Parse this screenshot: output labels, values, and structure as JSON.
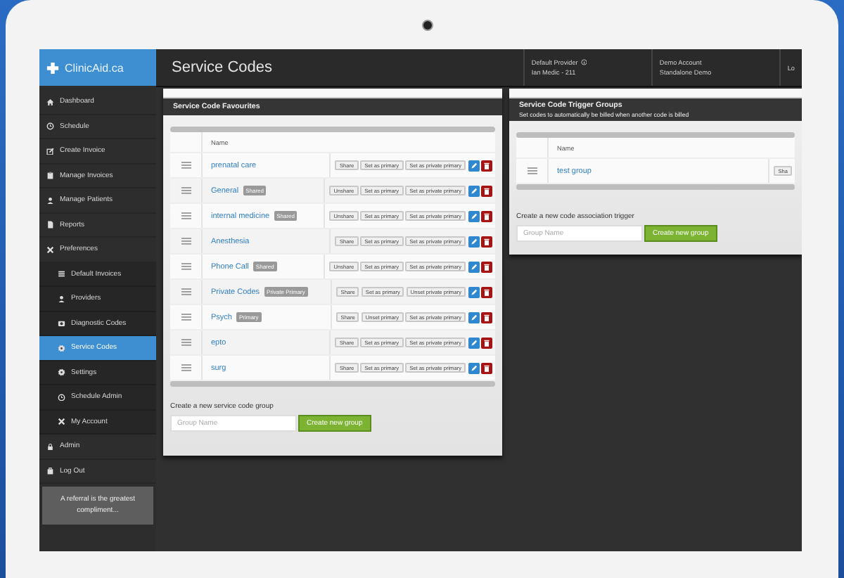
{
  "logo": "ClinicAid.ca",
  "sidebar": {
    "items": [
      {
        "label": "Dashboard",
        "selected": false
      },
      {
        "label": "Schedule",
        "selected": false
      },
      {
        "label": "Create Invoice",
        "selected": false
      },
      {
        "label": "Manage Invoices",
        "selected": false
      },
      {
        "label": "Manage Patients",
        "selected": false
      },
      {
        "label": "Reports",
        "selected": false
      },
      {
        "label": "Preferences",
        "selected": false,
        "children": [
          {
            "label": "Default Invoices",
            "selected": false
          },
          {
            "label": "Providers",
            "selected": false
          },
          {
            "label": "Diagnostic Codes",
            "selected": false
          },
          {
            "label": "Service Codes",
            "selected": true
          },
          {
            "label": "Settings",
            "selected": false
          },
          {
            "label": "Schedule Admin",
            "selected": false
          },
          {
            "label": "My Account",
            "selected": false
          }
        ]
      },
      {
        "label": "Admin",
        "selected": false
      },
      {
        "label": "Log Out",
        "selected": false
      }
    ],
    "promo": "A referral is the greatest compliment..."
  },
  "header": {
    "title": "Service Codes",
    "info": [
      {
        "label": "Default Provider",
        "info_icon": true,
        "value": "Ian Medic - 211"
      },
      {
        "label": "Demo Account",
        "value": "Standalone Demo"
      },
      {
        "label": "Lo"
      }
    ]
  },
  "favourites": {
    "title": "Service Code Favourites",
    "column": "Name",
    "rows": [
      {
        "name": "prenatal care",
        "actions": [
          "Share",
          "Set as primary",
          "Set as private primary"
        ]
      },
      {
        "name": "General",
        "badge": "Shared",
        "actions": [
          "Unshare",
          "Set as primary",
          "Set as private primary"
        ]
      },
      {
        "name": "internal medicine",
        "badge": "Shared",
        "actions": [
          "Unshare",
          "Set as primary",
          "Set as private primary"
        ]
      },
      {
        "name": "Anesthesia",
        "actions": [
          "Share",
          "Set as primary",
          "Set as private primary"
        ]
      },
      {
        "name": "Phone Call",
        "badge": "Shared",
        "actions": [
          "Unshare",
          "Set as primary",
          "Set as private primary"
        ]
      },
      {
        "name": "Private Codes",
        "badge": "Private Primary",
        "actions": [
          "Share",
          "Set as primary",
          "Unset private primary"
        ]
      },
      {
        "name": "Psych",
        "badge": "Primary",
        "actions": [
          "Share",
          "Unset primary",
          "Set as private primary"
        ]
      },
      {
        "name": "epto",
        "actions": [
          "Share",
          "Set as primary",
          "Set as private primary"
        ]
      },
      {
        "name": "surg",
        "actions": [
          "Share",
          "Set as primary",
          "Set as private primary"
        ]
      }
    ],
    "create": {
      "label": "Create a new service code group",
      "placeholder": "Group Name",
      "button": "Create new group"
    }
  },
  "triggers": {
    "title": "Service Code Trigger Groups",
    "subtitle": "Set codes to automatically be billed when another code is billed",
    "column": "Name",
    "rows": [
      {
        "name": "test group",
        "actions": [
          "Sha"
        ]
      }
    ],
    "create": {
      "label": "Create a new code association trigger",
      "placeholder": "Group Name",
      "button": "Create new group"
    }
  }
}
